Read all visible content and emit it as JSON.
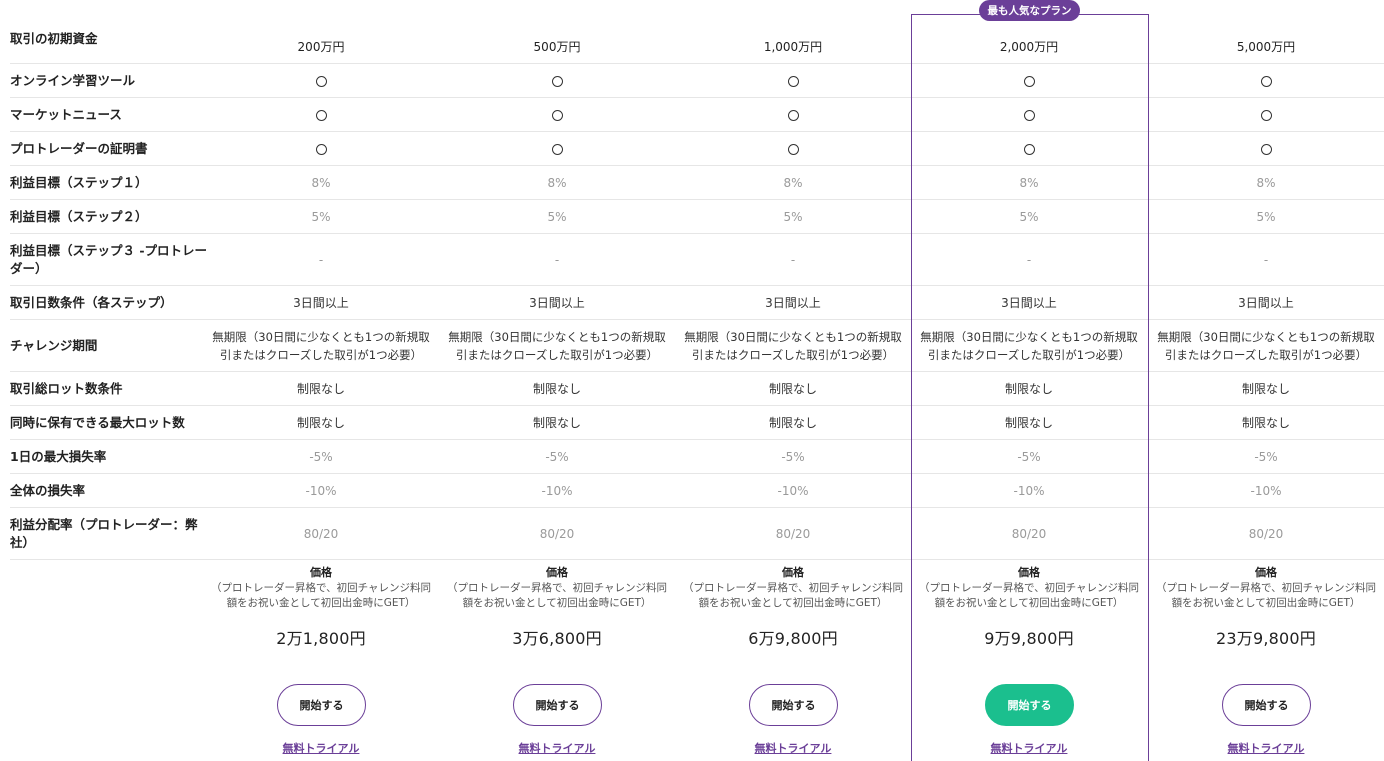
{
  "popular_badge": "最も人気なプラン",
  "plans": [
    {
      "capital": "200万円",
      "price": "2万1,800円"
    },
    {
      "capital": "500万円",
      "price": "3万6,800円"
    },
    {
      "capital": "1,000万円",
      "price": "6万9,800円"
    },
    {
      "capital": "2,000万円",
      "price": "9万9,800円"
    },
    {
      "capital": "5,000万円",
      "price": "23万9,800円"
    }
  ],
  "rows": {
    "initial_capital": "取引の初期資金",
    "learning_tools": "オンライン学習ツール",
    "market_news": "マーケットニュース",
    "certificate": "プロトレーダーの証明書",
    "profit_step1": "利益目標（ステップ１）",
    "profit_step2": "利益目標（ステップ２）",
    "profit_step3": "利益目標（ステップ３ -プロトレーダー）",
    "trading_days": "取引日数条件（各ステップ）",
    "challenge_period": "チャレンジ期間",
    "total_lots": "取引総ロット数条件",
    "max_lots": "同時に保有できる最大ロット数",
    "daily_loss": "1日の最大損失率",
    "total_loss": "全体の損失率",
    "profit_split": "利益分配率（プロトレーダー：弊社）"
  },
  "values": {
    "included": "〇",
    "profit_step1": "8%",
    "profit_step2": "5%",
    "profit_step3": "-",
    "trading_days": "3日間以上",
    "challenge_period": "無期限（30日間に少なくとも1つの新規取引またはクローズした取引が1つ必要）",
    "total_lots": "制限なし",
    "max_lots": "制限なし",
    "daily_loss": "-5%",
    "total_loss": "-10%",
    "profit_split": "80/20"
  },
  "pricing": {
    "heading": "価格",
    "note": "（プロトレーダー昇格で、初回チャレンジ料同額をお祝い金として初回出金時にGET）",
    "start_label": "開始する",
    "trial_label": "無料トライアル"
  },
  "colors": {
    "accent": "#6b3f98",
    "primary_button": "#1bbf8e"
  }
}
